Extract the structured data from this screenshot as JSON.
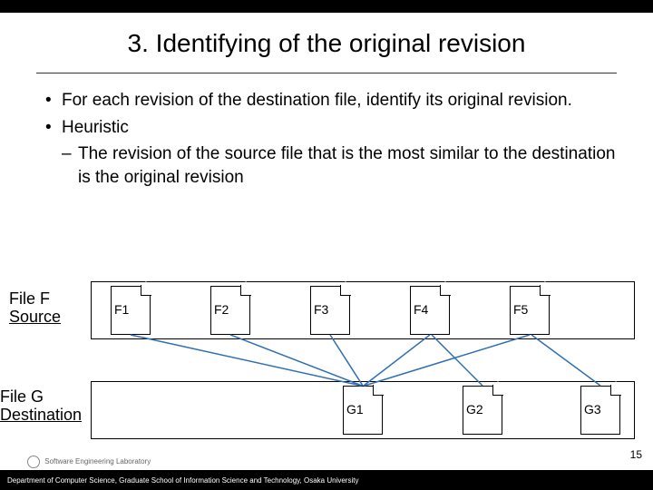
{
  "title": "3. Identifying of the original revision",
  "bullets": [
    {
      "level": 1,
      "text": "For each revision of the destination file, identify its original revision."
    },
    {
      "level": 1,
      "text": "Heuristic"
    },
    {
      "level": 2,
      "text": "The revision of the source file that is the most similar to the destination is the original revision"
    }
  ],
  "rows": {
    "source": {
      "title": "File F",
      "role": "Source",
      "files": [
        "F1",
        "F2",
        "F3",
        "F4",
        "F5"
      ]
    },
    "dest": {
      "title": "File G",
      "role": "Destination",
      "files": [
        "G1",
        "G2",
        "G3"
      ]
    }
  },
  "connections": [
    {
      "from": "F1",
      "to": "G1"
    },
    {
      "from": "F2",
      "to": "G1"
    },
    {
      "from": "F3",
      "to": "G1"
    },
    {
      "from": "F4",
      "to": "G1"
    },
    {
      "from": "F5",
      "to": "G1"
    },
    {
      "from": "F4",
      "to": "G2"
    },
    {
      "from": "F5",
      "to": "G3"
    }
  ],
  "page_number": "15",
  "footer": {
    "dept": "Department of Computer Science, Graduate School of Information Science and Technology, Osaka University",
    "lab": "Software Engineering Laboratory"
  },
  "colors": {
    "line": "#2f6fb3"
  }
}
